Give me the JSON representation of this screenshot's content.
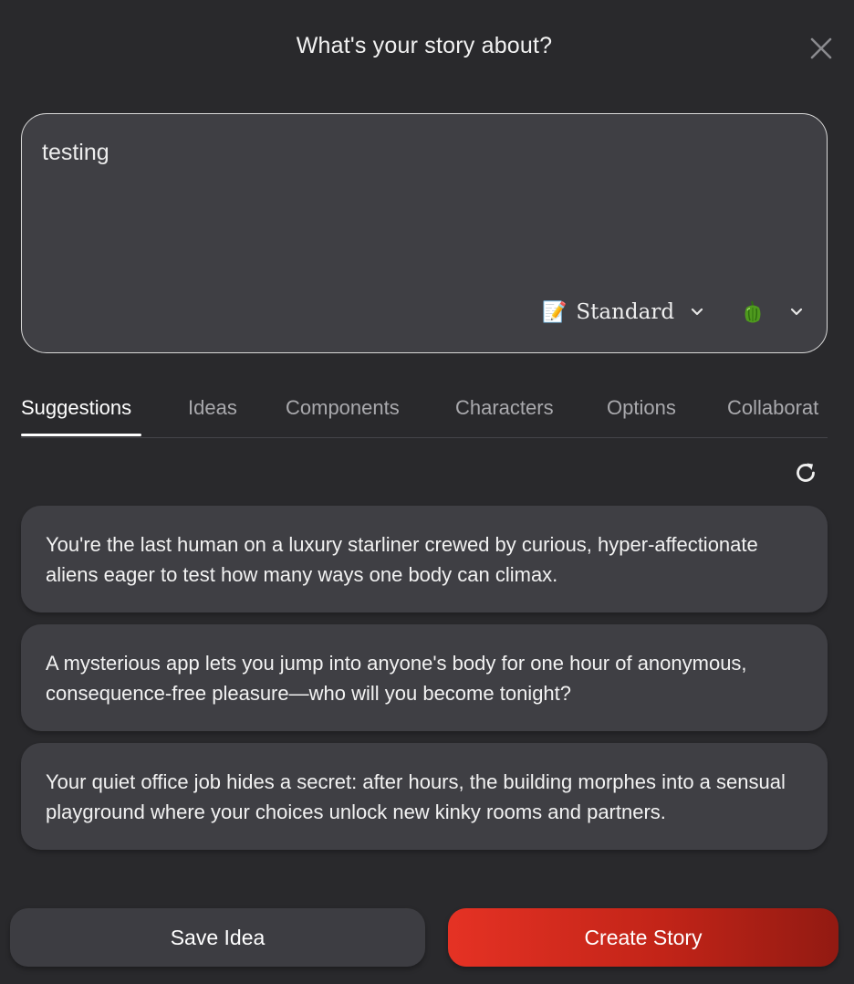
{
  "dialog": {
    "title": "What's your story about?",
    "close_icon": "close-icon"
  },
  "prompt": {
    "value": "testing",
    "style_emoji": "📝",
    "style_label": "Standard",
    "heat_icon": "green-pepper-icon"
  },
  "tabs": [
    {
      "label": "Suggestions",
      "active": true
    },
    {
      "label": "Ideas",
      "active": false
    },
    {
      "label": "Components",
      "active": false
    },
    {
      "label": "Characters",
      "active": false
    },
    {
      "label": "Options",
      "active": false
    },
    {
      "label": "Collaborat",
      "active": false
    }
  ],
  "suggestions": [
    {
      "text": "You're the last human on a luxury starliner crewed by curious, hyper-affectionate aliens eager to test how many ways one body can climax."
    },
    {
      "text": "A mysterious app lets you jump into anyone's body for one hour of anonymous, consequence-free pleasure—who will you become tonight?"
    },
    {
      "text": "Your quiet office job hides a secret: after hours, the building morphes into a sensual playground where your choices unlock new kinky rooms and partners."
    }
  ],
  "buttons": {
    "save_label": "Save Idea",
    "create_label": "Create Story"
  },
  "colors": {
    "background": "#29292c",
    "surface": "#3f3f44",
    "accent_start": "#e53224",
    "accent_end": "#921a12"
  }
}
